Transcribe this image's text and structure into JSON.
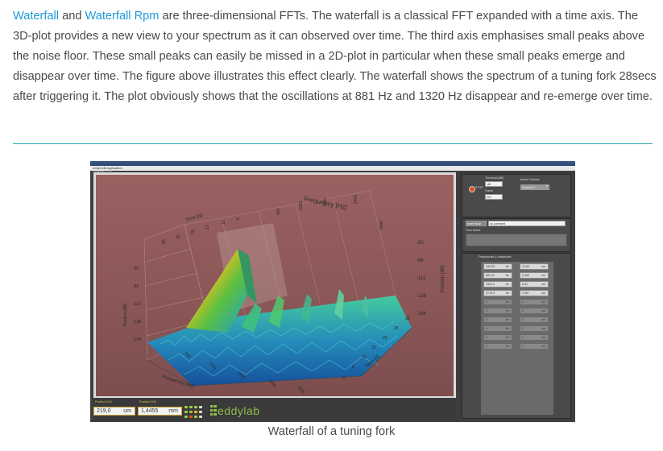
{
  "paragraph": {
    "link1": "Waterfall",
    "text1": " and ",
    "link2": "Waterfall Rpm",
    "text2": " are three-dimensional FFTs. The waterfall is a classical FFT expanded with a time axis. The 3D-plot provides a new view to your spectrum as it can observed over time. The third axis emphasises small peaks above the noise floor. These small peaks can easily be missed in a 2D-plot in particular when these small peaks emerge and disappear over time. The figure above illustrates this effect clearly. The waterfall shows the spectrum of a tuning fork 28secs after triggering it. The plot obviously shows that the oscillations at 881 Hz and 1320 Hz disappear and re-emerge over time."
  },
  "figure": {
    "window_title": "eddylab 2.0.1",
    "menu": "eddyLAB  Application",
    "plot": {
      "freq_axis_title": "Frequency [Hz]",
      "time_axis_title_back": "Time [s]",
      "time_axis_title_front": "Time [s]",
      "pos_axis_title_left": "Position [dB]",
      "pos_axis_title_right": "Position [dB]",
      "freq_ticks_back": [
        "600",
        "1200",
        "1800",
        "2400",
        "3000"
      ],
      "freq_ticks_front": [
        "600",
        "1200",
        "1800",
        "2400",
        "3000"
      ],
      "time_ticks_back": [
        "30",
        "25",
        "20",
        "15",
        "10",
        "5"
      ],
      "time_ticks_front": [
        "0",
        "5",
        "10",
        "15",
        "20",
        "25",
        "30"
      ],
      "db_ticks_left": [
        "-60",
        "-86",
        "-112",
        "-138",
        "-164"
      ],
      "db_ticks_right": [
        "-60",
        "-86",
        "-112",
        "-138",
        "-164"
      ],
      "db_ticks_mid": [
        "-60",
        "-86",
        "-112",
        "-138",
        "-164"
      ]
    },
    "side": {
      "stop_label": "STOP",
      "threshold_label": "Threshold [dB]",
      "threshold_value": "-dB",
      "frame_label": "Frame",
      "frame_value": "300",
      "active_channel_label": "Active Channel",
      "active_channel_value": "Channel 2",
      "insert_button": "Insert Note",
      "comment_value": "no comment",
      "time_select_label": "Time Select",
      "freq_amp_label": "Frequencies & Amplitudes",
      "rows": [
        {
          "freq": "440,05",
          "freq_unit": "Hz",
          "amp": "73,83",
          "amp_unit": "um"
        },
        {
          "freq": "881,22",
          "freq_unit": "Hz",
          "amp": "0,405",
          "amp_unit": "um"
        },
        {
          "freq": "1320,2",
          "freq_unit": "Hz",
          "amp": "0,31",
          "amp_unit": "um"
        },
        {
          "freq": "2719,9",
          "freq_unit": "Hz",
          "amp": "1,357",
          "amp_unit": "um"
        },
        {
          "freq": "0",
          "freq_unit": "Hz",
          "amp": "0",
          "amp_unit": "um"
        },
        {
          "freq": "0",
          "freq_unit": "Hz",
          "amp": "0",
          "amp_unit": "um"
        },
        {
          "freq": "0",
          "freq_unit": "Hz",
          "amp": "0",
          "amp_unit": "um"
        },
        {
          "freq": "0",
          "freq_unit": "Hz",
          "amp": "0",
          "amp_unit": "um"
        },
        {
          "freq": "0",
          "freq_unit": "Hz",
          "amp": "0",
          "amp_unit": "um"
        },
        {
          "freq": "0",
          "freq_unit": "Hz",
          "amp": "0",
          "amp_unit": "um"
        }
      ]
    },
    "bottom": {
      "pos_ch1_label": "Position CH1",
      "pos_ch1_value": "219,0",
      "pos_ch1_unit": "um",
      "pos_ch2_label": "Position CH2",
      "pos_ch2_value": "1,4455",
      "pos_ch2_unit": "mm",
      "logo_text": "eddylab"
    }
  },
  "caption": "Waterfall of a tuning fork",
  "colors": {
    "link": "#1e9ad6",
    "rule": "#26a8b8",
    "plot_bg": "#8a5656",
    "logo": "#8fbf4a"
  }
}
